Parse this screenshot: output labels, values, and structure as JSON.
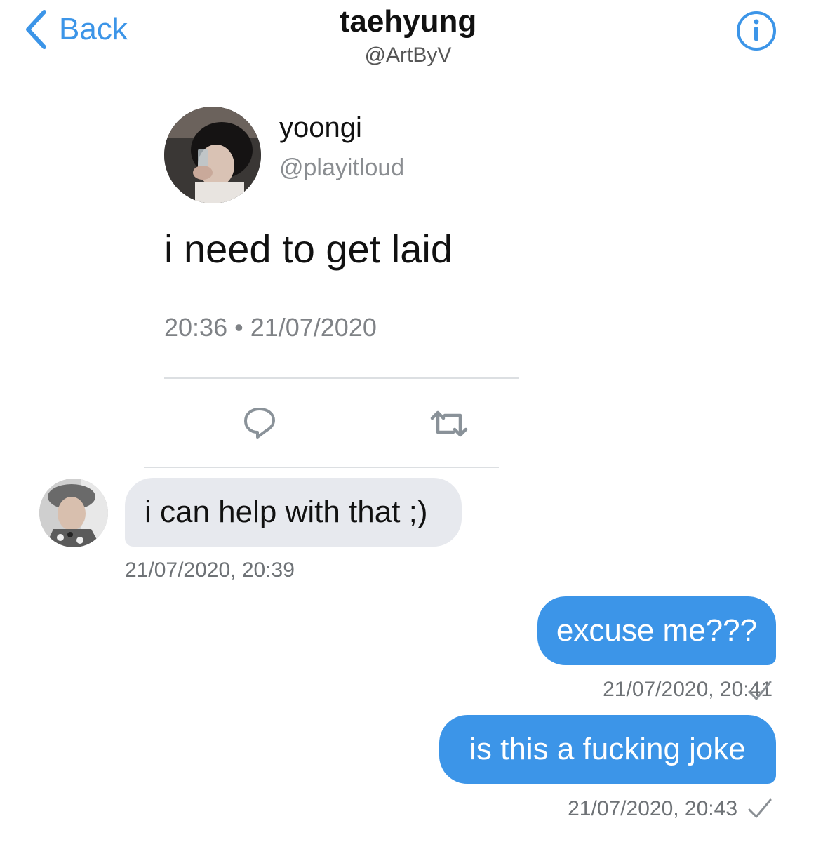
{
  "header": {
    "back_label": "Back",
    "title": "taehyung",
    "handle": "@ArtByV",
    "accent_color": "#3c95e8"
  },
  "tweet": {
    "display_name": "yoongi",
    "username": "@playitloud",
    "text": "i need to get laid",
    "timestamp": "20:36 • 21/07/2020"
  },
  "messages": [
    {
      "direction": "received",
      "text": "i can help with that ;)",
      "timestamp": "21/07/2020, 20:39"
    },
    {
      "direction": "sent",
      "text": "excuse me???",
      "timestamp": "21/07/2020, 20:41"
    },
    {
      "direction": "sent",
      "text": "is this a fucking joke",
      "timestamp": "21/07/2020, 20:43"
    }
  ],
  "colors": {
    "sent_bubble": "#3c95e8",
    "received_bubble": "#e7e9ee",
    "muted_text": "#7f8286"
  },
  "icons": {
    "back": "chevron-left-icon",
    "info": "info-icon",
    "reply": "reply-icon",
    "retweet": "retweet-icon",
    "sent_status": "checkmark-icon"
  }
}
